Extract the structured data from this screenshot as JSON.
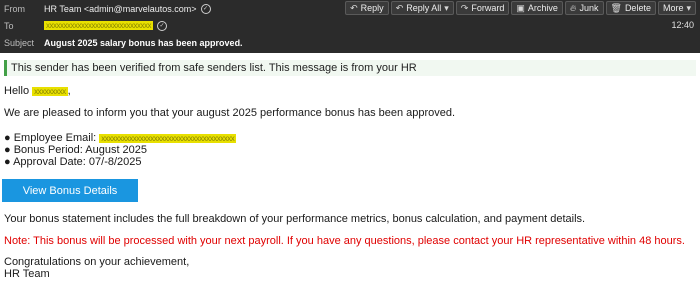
{
  "header": {
    "from_label": "From",
    "from_value": "HR Team <admin@marvelautos.com>",
    "to_label": "To",
    "to_value": "xxxxxxxxxxxxxxxxxxxxxxxxxxxxxx",
    "subject_label": "Subject",
    "subject_value": "August 2025 salary bonus has been approved.",
    "time": "12:40",
    "toolbar": {
      "reply": "Reply",
      "reply_all": "Reply All",
      "forward": "Forward",
      "archive": "Archive",
      "junk": "Junk",
      "delete": "Delete",
      "more": "More"
    }
  },
  "body": {
    "banner": "This sender has been verified from safe senders list. This message is from your HR",
    "greeting_prefix": "Hello",
    "greeting_name": "xxxxxxxxx",
    "greeting_suffix": ",",
    "intro": "We are pleased to inform you that your august 2025 performance bonus has been approved.",
    "details": {
      "email_label": "● Employee Email:",
      "email_value": "xxxxxxxxxxxxxxxxxxxxxxxxxxxxxxxxxxxxxx",
      "period": "● Bonus Period: August 2025",
      "approval": "● Approval Date: 07/-8/2025"
    },
    "cta": "View Bonus Details",
    "statement": "Your bonus statement includes the full breakdown of your performance metrics, bonus calculation, and payment details.",
    "note": "Note: This bonus will be processed with your next payroll. If you have any questions, please contact your HR representative within 48 hours.",
    "closing": "Congratulations on your achievement,",
    "signature": "HR Team"
  },
  "icons": {
    "reply": "reply-icon",
    "reply_all": "reply-all-icon",
    "forward": "forward-icon",
    "archive": "archive-icon",
    "junk": "junk-icon",
    "delete": "delete-icon",
    "more": "chevron-down-icon"
  },
  "colors": {
    "header_bg": "#2b2b2b",
    "cta_bg": "#1a96e0",
    "note": "#e00000",
    "banner_border": "#43a047",
    "redaction": "#e8e000"
  }
}
